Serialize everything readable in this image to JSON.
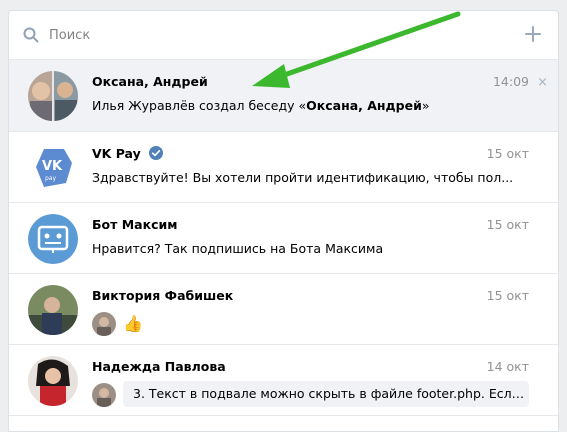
{
  "search": {
    "placeholder": "Поиск"
  },
  "dialogs": [
    {
      "name": "Оксана, Андрей",
      "time": "14:09",
      "msg_prefix": "Илья Журавлёв создал беседу «",
      "msg_bold": "Оксана, Андрей",
      "msg_suffix": "»",
      "close": "×"
    },
    {
      "name": "VK Pay",
      "time": "15 окт",
      "message": "Здравствуйте! Вы хотели пройти идентификацию, чтобы пол...",
      "verified": true
    },
    {
      "name": "Бот Максим",
      "time": "15 окт",
      "message": "Нравится? Так подпишись на Бота Максима"
    },
    {
      "name": "Виктория Фабишек",
      "time": "15 окт",
      "message": "👍"
    },
    {
      "name": "Надежда Павлова",
      "time": "14 окт",
      "message": "3. Текст в подвале можно скрыть в файле footer.php. Если там ..."
    }
  ],
  "colors": {
    "accent": "#5181b8",
    "arrow": "#3cb82f",
    "muted": "#939393"
  }
}
